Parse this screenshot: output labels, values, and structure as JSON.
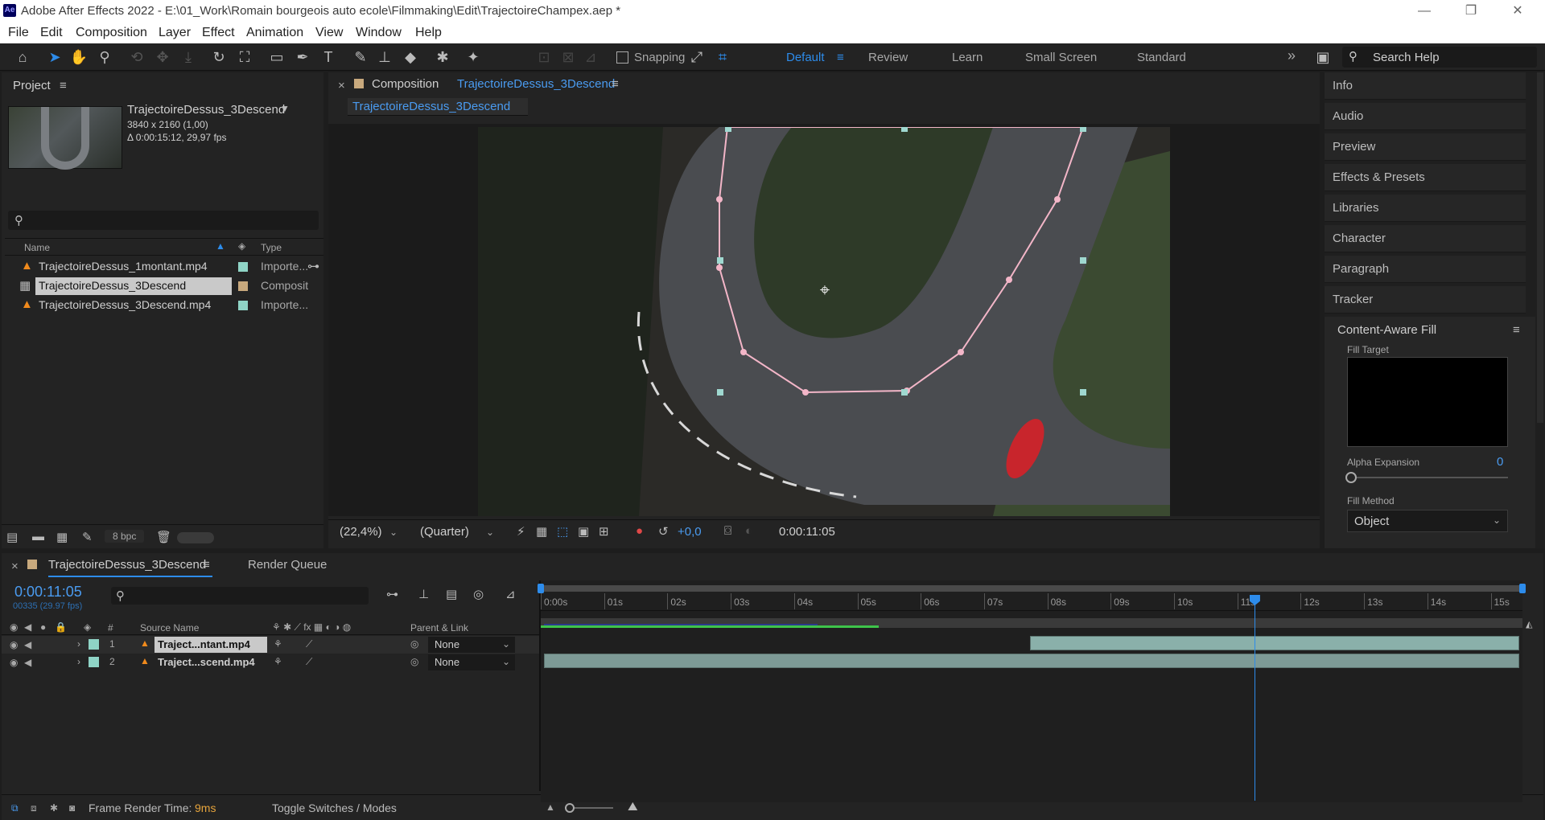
{
  "titlebar": {
    "title": "Adobe After Effects 2022 - E:\\01_Work\\Romain bourgeois auto ecole\\Filmmaking\\Edit\\TrajectoireChampex.aep *",
    "logo": "Ae",
    "minimize": "—",
    "restore": "❐",
    "close": "✕"
  },
  "menu": [
    "File",
    "Edit",
    "Composition",
    "Layer",
    "Effect",
    "Animation",
    "View",
    "Window",
    "Help"
  ],
  "toolbar": {
    "snapping": "Snapping",
    "workspaces": [
      "Default",
      "Review",
      "Learn",
      "Small Screen",
      "Standard"
    ],
    "more": "»",
    "search_placeholder": "Search Help"
  },
  "project": {
    "tab": "Project",
    "comp_name": "TrajectoireDessus_3Descend",
    "dims": "3840 x 2160 (1,00)",
    "duration": "Δ 0:00:15:12, 29,97 fps",
    "search_placeholder": "",
    "col_name": "Name",
    "col_type": "Type",
    "items": [
      {
        "name": "TrajectoireDessus_1montant.mp4",
        "type": "Importe...",
        "color": "#8fd4c6",
        "kind": "footage"
      },
      {
        "name": "TrajectoireDessus_3Descend",
        "type": "Composit",
        "color": "#c8a97d",
        "kind": "comp"
      },
      {
        "name": "TrajectoireDessus_3Descend.mp4",
        "type": "Importe...",
        "color": "#8fd4c6",
        "kind": "footage"
      }
    ],
    "bpc": "8 bpc"
  },
  "composition": {
    "tab_prefix": "Composition",
    "tab_name": "TrajectoireDessus_3Descend",
    "subtab": "TrajectoireDessus_3Descend",
    "zoom": "(22,4%)",
    "resolution": "(Quarter)",
    "exposure": "+0,0",
    "timecode": "0:00:11:05"
  },
  "right_panels": [
    "Info",
    "Audio",
    "Preview",
    "Effects & Presets",
    "Libraries",
    "Character",
    "Paragraph",
    "Tracker"
  ],
  "caf": {
    "title": "Content-Aware Fill",
    "fill_target": "Fill Target",
    "alpha_expansion": "Alpha Expansion",
    "alpha_value": "0",
    "fill_method": "Fill Method",
    "fill_method_value": "Object"
  },
  "timeline": {
    "tab": "TrajectoireDessus_3Descend",
    "render_queue": "Render Queue",
    "timecode": "0:00:11:05",
    "frames": "00335 (29.97 fps)",
    "col_hash": "#",
    "col_source": "Source Name",
    "col_parent": "Parent & Link",
    "ticks": [
      "0:00s",
      "01s",
      "02s",
      "03s",
      "04s",
      "05s",
      "06s",
      "07s",
      "08s",
      "09s",
      "10s",
      "11s",
      "12s",
      "13s",
      "14s",
      "15s"
    ],
    "playhead_fraction": 0.727,
    "layers": [
      {
        "num": "1",
        "name": "Traject...ntant.mp4",
        "parent": "None",
        "color": "#8fd4c6",
        "start_fraction": 0.495,
        "end_fraction": 1.0,
        "selected": true
      },
      {
        "num": "2",
        "name": "Traject...scend.mp4",
        "parent": "None",
        "color": "#8fd4c6",
        "start_fraction": 0.0,
        "end_fraction": 1.0,
        "selected": false
      }
    ],
    "frame_render_label": "Frame Render Time:",
    "frame_render_value": "9ms",
    "toggle": "Toggle Switches / Modes"
  },
  "colors": {
    "accent": "#2d8ceb",
    "panel": "#232323",
    "bg": "#1d1d1d",
    "layer_bar": "#8ab0aa",
    "mask": "#f3b6c8"
  }
}
